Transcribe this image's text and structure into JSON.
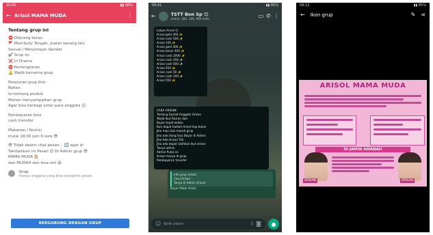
{
  "phone1": {
    "status": {
      "time": "10:05",
      "icons": "▮▮ 48%"
    },
    "appbar": {
      "title": "Arisol MAMA MUDA"
    },
    "heading": "Tentang grup ini",
    "lines": [
      "⛔ Dilarang keras:",
      "🚩 Membully Tengah, Jualan barang lain",
      "Sexual / Menyimpan Gender",
      "✔️ Grup ini",
      "❌ Iri Drama",
      "⛔ Pertengkaran",
      "🔔 Wajib bersama grup"
    ],
    "block2": [
      "Peraturan grup this:",
      "Bahas:",
      "Isi tentang produk",
      "Mohon menyampaikan grup",
      "Agar bisa berbagi antar para anggota 😊"
    ],
    "block3": [
      "Pembayaran bisa",
      "cash transfer"
    ],
    "block4": [
      "Makanan / Nutrisi",
      "mulai 18:00 jam 6 sore 😎"
    ],
    "block5": [
      "😎 Tidak dalam chat pesan... 🔄 agar di",
      "Tambahkan ini Pesan 😊 Di Admin grup 😎",
      "MAMA MUDA 🏠",
      "dan MUDAH dan bisa sini 😆"
    ],
    "group": {
      "title": "Grup",
      "subtitle": "Hanya anggota yang bisa mengirim pesan"
    },
    "join_label": "BERGABUNG DENGAN GRUP"
  },
  "phone2": {
    "status": {
      "time": "09:41",
      "icons": "▮▮ 85%"
    },
    "appbar": {
      "title": "TSTT Bon Sp 😊",
      "subtitle": "online, 182, 160, 999 ketik..."
    },
    "bubble1": [
      "Lokasi Arisol ☺",
      "Arisol gold 300 ✨",
      "Arisol cash 500 ✨",
      "Arisol 100 ✨",
      "Arisol gold 300 ✨",
      "Arisol besar 400 ✨",
      "Arisol cash 2000 ✨",
      "Arisol cash 350 ✨",
      "Arisol cash 500 ✨",
      "Arisol 450 ✨",
      "Arisol cash 50 ✨",
      "Arisol cash 100 ✨",
      "Arisol 550 ✨"
    ],
    "bubble2": [
      "CARA ARISAN:",
      "Tentang Syarat Anggota Arisan",
      "Wajib Ikut Aturan dari",
      "Bayar tepat waktu",
      "Bon dapat hadiah Arisol tiap bulan",
      "Jika mau ikut masuk grup",
      "Jika ada Uang Sisa Bayar di Admin",
      "Jika Ada Arisan Trik",
      "Jika ada dapat silahkan ikut arisan",
      "Tanya admin",
      "Admin Pulsa isi",
      "Arisan hanya di grup",
      "Pembayaran transfer"
    ],
    "green": [
      "Info grup arisan",
      "Cara Arisan",
      "Tanya di Admin Arisan",
      "Bayar Pakai Arisol"
    ],
    "input_placeholder": "Ketik pesan"
  },
  "phone3": {
    "status": {
      "time": "09:12",
      "icons": "▮▮ 85%"
    },
    "appbar": {
      "title": "Ikon grup"
    },
    "poster": {
      "title": "ARISOL MAMA MUDA",
      "banner": "DI JAMIN AMANAH",
      "tag_left": "ARISAN",
      "tag_right": "ARISAN"
    }
  }
}
